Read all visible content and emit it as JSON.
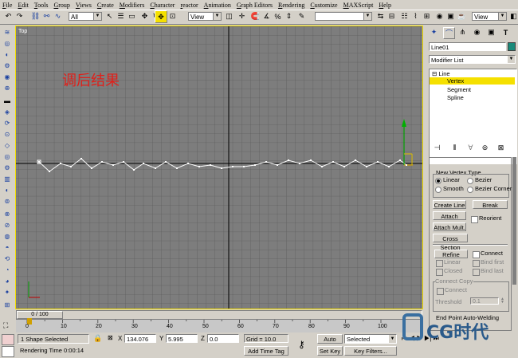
{
  "menu": [
    "File",
    "Edit",
    "Tools",
    "Group",
    "Views",
    "Create",
    "Modifiers",
    "Character",
    "reactor",
    "Animation",
    "Graph Editors",
    "Rendering",
    "Customize",
    "MAXScript",
    "Help"
  ],
  "toolbar": {
    "selection_filter": "All",
    "ref_coord": "View",
    "ref_coord_right": "View"
  },
  "viewport": {
    "label": "Top",
    "annotation": "调后结果",
    "annotation_color": "#e0201a",
    "background": "#7d7d7d"
  },
  "panel": {
    "object_name": "Line01",
    "object_color": "#1a8a7a",
    "modifier_list": "Modifier List",
    "stack": [
      {
        "label": "Line"
      },
      {
        "label": "Vertex"
      },
      {
        "label": "Segment"
      },
      {
        "label": "Spline"
      }
    ],
    "new_vertex_type": "New Vertex Type",
    "radios": [
      "Linear",
      "Bezier",
      "Smooth",
      "Bezier Corner"
    ],
    "buttons": {
      "create_line": "Create Line",
      "break": "Break",
      "attach": "Attach",
      "reorient": "Reorient",
      "attach_mult": "Attach Mult.",
      "cross_section": "Cross Section",
      "refine": "Refine",
      "connect": "Connect",
      "linear": "Linear",
      "bind_first": "Bind first",
      "closed": "Closed",
      "bind_last": "Bind last"
    },
    "connect_copy": "Connect Copy",
    "connect2": "Connect",
    "threshold_label": "Threshold",
    "threshold_value": "0.1",
    "end_point": "End Point Auto-Welding"
  },
  "time": {
    "frame": "0 / 100",
    "ticks": [
      "0",
      "10",
      "20",
      "30",
      "40",
      "50",
      "60",
      "70",
      "80",
      "90",
      "100"
    ]
  },
  "status": {
    "selection": "1 Shape Selected",
    "render_time": "Rendering Time  0:00:14",
    "x_label": "X",
    "x_value": "134.076",
    "y_label": "Y",
    "y_value": "5.995",
    "z_label": "Z",
    "z_value": "0.0",
    "grid": "Grid = 10.0",
    "add_time_tag": "Add Time Tag",
    "auto_key": "Auto Key",
    "selected": "Selected",
    "set_key": "Set Key",
    "key_filters": "Key Filters...",
    "watermark": "CG时代"
  }
}
